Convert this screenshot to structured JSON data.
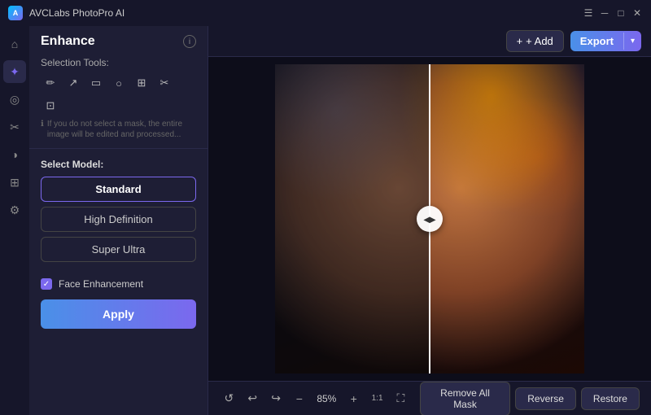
{
  "app": {
    "title": "AVCLabs PhotoPro AI",
    "icon": "A"
  },
  "titlebar": {
    "controls": [
      "menu",
      "minimize",
      "maximize",
      "close"
    ]
  },
  "header": {
    "title": "Enhance",
    "info_label": "i"
  },
  "toolbar": {
    "add_label": "+ Add",
    "export_label": "Export",
    "export_arrow": "▾"
  },
  "left_panel": {
    "selection_tools_label": "Selection Tools:",
    "info_note": "If you do not select a mask, the entire image will be edited and processed...",
    "tools": [
      "✏",
      "↗",
      "▭",
      "○",
      "⊞",
      "✂",
      "⊡"
    ],
    "select_model_label": "Select Model:",
    "models": [
      {
        "label": "Standard",
        "selected": true
      },
      {
        "label": "High Definition",
        "selected": false
      },
      {
        "label": "Super Ultra",
        "selected": false
      }
    ],
    "face_enhancement_label": "Face Enhancement",
    "face_enhancement_checked": true,
    "apply_label": "Apply"
  },
  "bottom_bar": {
    "zoom_percent": "85%",
    "zoom_one_to_one": "1:1",
    "remove_all_mask_label": "Remove All Mask",
    "reverse_label": "Reverse",
    "restore_label": "Restore"
  },
  "rail_icons": [
    {
      "name": "home-icon",
      "symbol": "⌂",
      "active": false
    },
    {
      "name": "enhance-icon",
      "symbol": "✦",
      "active": true
    },
    {
      "name": "object-icon",
      "symbol": "◎",
      "active": false
    },
    {
      "name": "cutout-icon",
      "symbol": "✂",
      "active": false
    },
    {
      "name": "color-icon",
      "symbol": "◑",
      "active": false
    },
    {
      "name": "transform-icon",
      "symbol": "⊞",
      "active": false
    },
    {
      "name": "adjust-icon",
      "symbol": "⚙",
      "active": false
    }
  ]
}
